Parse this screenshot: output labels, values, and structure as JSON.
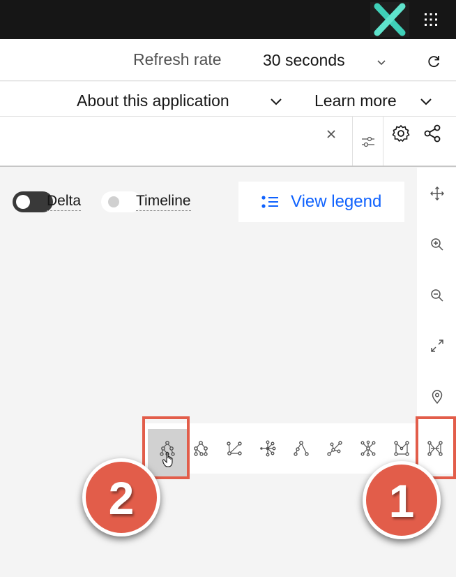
{
  "header": {
    "logo": "x-logo-icon",
    "apps_icon": "app-switcher-grid-icon"
  },
  "refresh": {
    "label": "Refresh rate",
    "value": "30 seconds",
    "chevron_icon": "chevron-down-icon",
    "refresh_icon": "refresh-icon"
  },
  "menus": {
    "about": "About this application",
    "learn": "Learn more"
  },
  "toolbar": {
    "clear_icon": "close-icon",
    "filter_icon": "filter-sliders-icon",
    "settings_icon": "gear-icon",
    "share_icon": "share-icon"
  },
  "controls": {
    "delta_label": "Delta",
    "delta_on": false,
    "timeline_label": "Timeline",
    "timeline_on": false,
    "view_legend_label": "View legend"
  },
  "side_rail": [
    "pan-icon",
    "zoom-in-icon",
    "zoom-out-icon",
    "fit-to-screen-icon",
    "locate-icon"
  ],
  "layouts": [
    {
      "icon": "hierarchy-layout-icon",
      "active": true
    },
    {
      "icon": "hierarchy-alt-layout-icon",
      "active": false
    },
    {
      "icon": "tree-branch-layout-icon",
      "active": false
    },
    {
      "icon": "radial-layout-icon",
      "active": false
    },
    {
      "icon": "top-down-tree-layout-icon",
      "active": false
    },
    {
      "icon": "force-layout-icon",
      "active": false
    },
    {
      "icon": "star-layout-icon",
      "active": false
    },
    {
      "icon": "grid-layout-icon",
      "active": false
    },
    {
      "icon": "bipartite-layout-icon",
      "active": false
    }
  ],
  "annotations": {
    "callout_1": "1",
    "callout_2": "2",
    "accent_color": "#e25d4a"
  },
  "colors": {
    "topbar": "#161616",
    "link": "#0f62fe",
    "canvas": "#f4f4f4"
  }
}
